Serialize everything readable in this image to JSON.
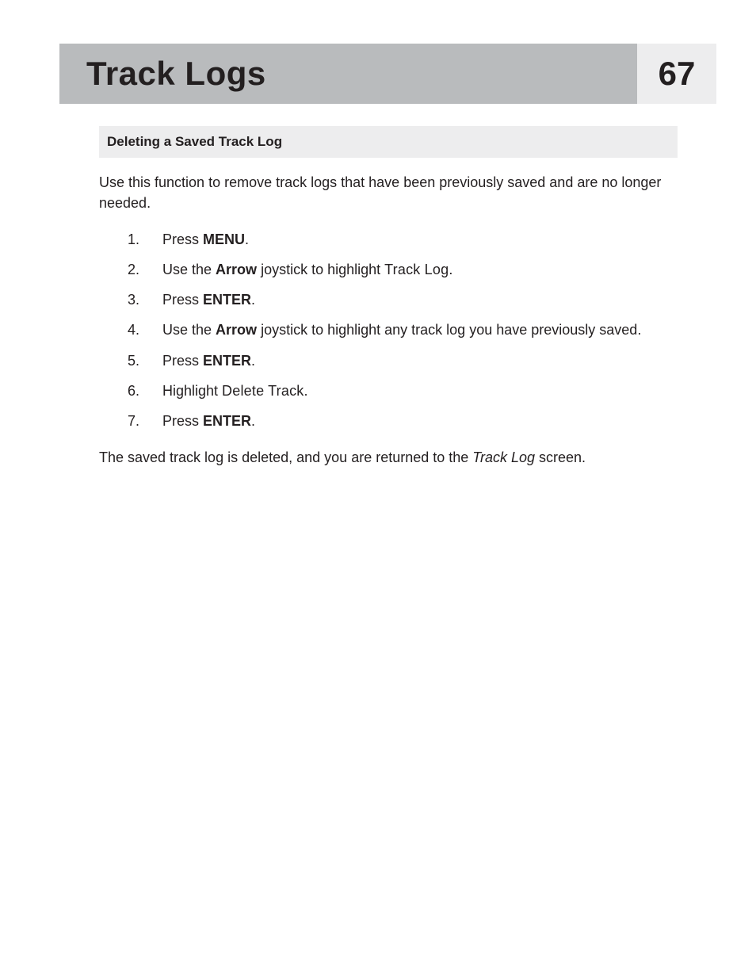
{
  "header": {
    "title": "Track Logs",
    "page_number": "67"
  },
  "section": {
    "heading": "Deleting a Saved Track Log",
    "intro": "Use this function to remove track logs that have been previously saved and are no longer needed.",
    "steps": [
      {
        "num": "1.",
        "pre": "Press ",
        "bold": "MENU",
        "post": "."
      },
      {
        "num": "2.",
        "pre": "Use the ",
        "bold": "Arrow",
        "mid": " joystick to highlight ",
        "ui": "Track Log",
        "post": "."
      },
      {
        "num": "3.",
        "pre": "Press ",
        "bold": "ENTER",
        "post": "."
      },
      {
        "num": "4.",
        "pre": "Use the ",
        "bold": "Arrow",
        "post": " joystick to highlight any track log you have previously saved."
      },
      {
        "num": "5.",
        "pre": "Press ",
        "bold": "ENTER",
        "post": "."
      },
      {
        "num": "6.",
        "pre": "Highlight ",
        "ui": "Delete Track",
        "post": "."
      },
      {
        "num": "7.",
        "pre": "Press ",
        "bold": "ENTER",
        "post": "."
      }
    ],
    "outro_pre": "The saved track log is deleted, and you are returned to the ",
    "outro_italic": "Track Log",
    "outro_post": " screen."
  }
}
